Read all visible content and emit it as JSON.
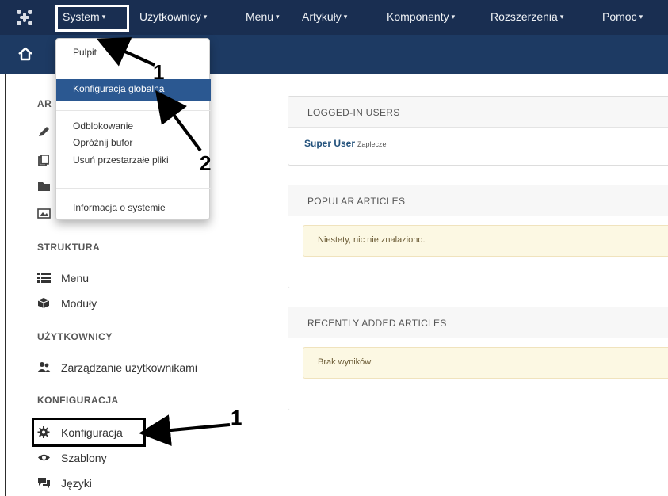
{
  "navbar": {
    "logo_icon": "joomla-logo-icon",
    "items": [
      {
        "label": "System",
        "caret": "▾"
      },
      {
        "label": "Użytkownicy",
        "caret": "▾"
      },
      {
        "label": "Menu",
        "caret": "▾"
      },
      {
        "label": "Artykuły",
        "caret": "▾"
      },
      {
        "label": "Komponenty",
        "caret": "▾"
      },
      {
        "label": "Rozszerzenia",
        "caret": "▾"
      },
      {
        "label": "Pomoc",
        "caret": "▾"
      }
    ]
  },
  "subbar": {
    "home_icon": "home-icon"
  },
  "dropdown": {
    "items": [
      "Pulpit",
      "Konfiguracja globalna",
      "Odblokowanie",
      "Opróżnij bufor",
      "Usuń przestarzałe pliki",
      "Informacja o systemie"
    ]
  },
  "sidebar": {
    "partial_heading": "AR",
    "sections": [
      {
        "heading": "STRUKTURA",
        "items": [
          {
            "label": "Menu",
            "icon": "list-icon"
          },
          {
            "label": "Moduły",
            "icon": "cube-icon"
          }
        ]
      },
      {
        "heading": "UŻYTKOWNICY",
        "items": [
          {
            "label": "Zarządzanie użytkownikami",
            "icon": "users-icon"
          }
        ]
      },
      {
        "heading": "KONFIGURACJA",
        "items": [
          {
            "label": "Konfiguracja",
            "icon": "gear-icon"
          },
          {
            "label": "Szablony",
            "icon": "eye-icon"
          },
          {
            "label": "Języki",
            "icon": "comments-icon"
          }
        ]
      }
    ]
  },
  "panels": {
    "logged_in": {
      "title": "LOGGED-IN USERS",
      "user": "Super User",
      "location": "Zaplecze"
    },
    "popular": {
      "title": "POPULAR ARTICLES",
      "message": "Niestety, nic nie znalaziono."
    },
    "recent": {
      "title": "RECENTLY ADDED ARTICLES",
      "message": "Brak wyników"
    }
  },
  "annotations": {
    "label_1": "1",
    "label_2": "2",
    "label_1b": "1"
  },
  "colors": {
    "navbar": "#192e51",
    "subbar": "#1d3a63",
    "active_menu": "#2b5891",
    "alert_bg": "#fcf8e3"
  }
}
